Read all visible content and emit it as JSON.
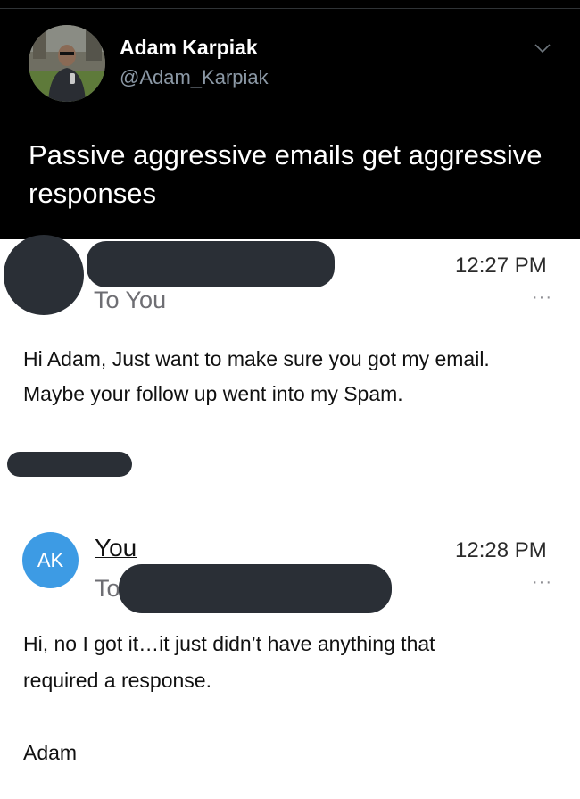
{
  "tweet": {
    "author_name": "Adam Karpiak",
    "handle": "@Adam_Karpiak",
    "text": "Passive aggressive emails get aggressive responses"
  },
  "email1": {
    "to_label": "To You",
    "time": "12:27 PM",
    "more": "···",
    "body_line1": "Hi Adam, Just want to make sure you got my email.",
    "body_line2": "Maybe your follow up went into my Spam."
  },
  "email2": {
    "avatar_initials": "AK",
    "sender": "You",
    "to_label": "To",
    "time": "12:28 PM",
    "more": "···",
    "body_line1": "Hi, no I got it…it just didn’t have anything that",
    "body_line2": "required a response.",
    "signature": "Adam"
  },
  "colors": {
    "tweet_background": "#000000",
    "redaction": "#2a2f36",
    "ak_avatar": "#3d9be4"
  },
  "icons": [
    "chevron-down-icon",
    "more-options-icon"
  ]
}
